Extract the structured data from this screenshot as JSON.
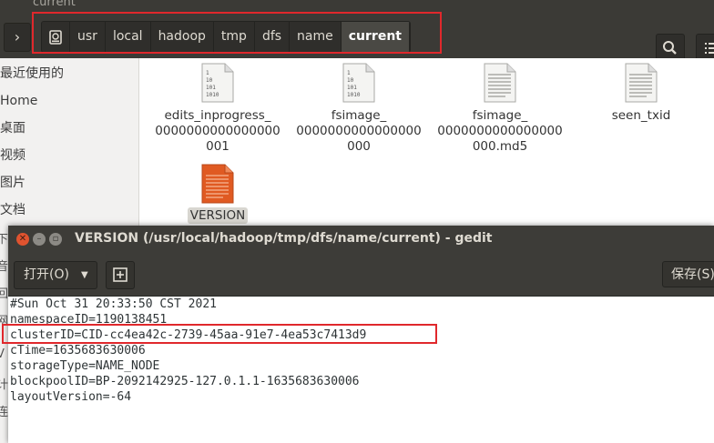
{
  "nautilus": {
    "window_title": "current",
    "forward_label": "›",
    "path": [
      "usr",
      "local",
      "hadoop",
      "tmp",
      "dfs",
      "name",
      "current"
    ],
    "sidebar": [
      "最近使用的",
      "Home",
      "桌面",
      "视频",
      "图片",
      "文档"
    ],
    "partial_sidebar": [
      "下",
      "音",
      "回",
      "网",
      "V",
      "计",
      "连"
    ],
    "files": [
      {
        "lines": [
          "edits_inprogress_",
          "0000000000000000",
          "001"
        ],
        "icon": "binary-file-icon"
      },
      {
        "lines": [
          "fsimage_",
          "0000000000000000",
          "000"
        ],
        "icon": "binary-file-icon"
      },
      {
        "lines": [
          "fsimage_",
          "0000000000000000",
          "000.md5"
        ],
        "icon": "text-file-icon"
      },
      {
        "lines": [
          "seen_txid"
        ],
        "icon": "text-file-icon"
      },
      {
        "lines": [
          "VERSION"
        ],
        "icon": "text-file-orange-icon"
      }
    ],
    "binary_glyph": [
      "1",
      "10",
      "101",
      "1010"
    ]
  },
  "gedit": {
    "title": "VERSION (/usr/local/hadoop/tmp/dfs/name/current) - gedit",
    "open_label": "打开(O)",
    "save_label": "保存(S)",
    "lines": [
      "#Sun Oct 31 20:33:50 CST 2021",
      "namespaceID=1190138451",
      "clusterID=CID-cc4ea42c-2739-45aa-91e7-4ea53c7413d9",
      "cTime=1635683630006",
      "storageType=NAME_NODE",
      "blockpoolID=BP-2092142925-127.0.1.1-1635683630006",
      "layoutVersion=-64"
    ]
  },
  "colors": {
    "highlight": "#e0282c",
    "accent_orange": "#e05a22",
    "titlebar": "#3d3c38"
  }
}
